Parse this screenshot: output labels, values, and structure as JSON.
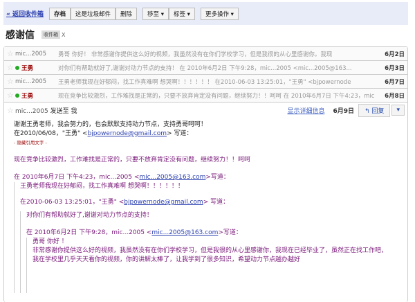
{
  "toolbar": {
    "back": "« 返回收件箱",
    "archive": "存档",
    "spam": "这是垃圾邮件",
    "delete": "删除",
    "move": "移至 ▾",
    "label": "标签 ▾",
    "more": "更多操作 ▾"
  },
  "subject": "感谢信",
  "tag": "收件箱",
  "tag_close": "X",
  "rows": [
    {
      "from": "mic...2005",
      "snippet": "勇哥 你好！ 非常感谢你提供这么好的视频，我虽然没有在你们学校学习，但是我很的从心里感谢你。我现",
      "date": "6月2日"
    },
    {
      "from": "王勇",
      "snippet": "对你们有帮助就好了,谢谢对动力节点的支持！ 在 2010年6月2日 下午9:28，mic...2005 <mic...2005@163...",
      "date": "6月3日"
    },
    {
      "from": "mic...2005",
      "snippet": "王勇老师我现在好郁闷，找工作真难啊 想哭啊！！！！！！ 在2010-06-03 13:25:01，\"王勇\" <bjpowernode",
      "date": "6月7日"
    },
    {
      "from": "王勇",
      "snippet": "现在竞争比较激烈，工作难找是正常的，只要不放弃肯定没有问题，继续努力！！呵呵 在 2010年6月7日 下午4:23，mic",
      "date": "6月8日"
    }
  ],
  "open": {
    "from": "mic...2005",
    "to": "发送至 我",
    "details": "显示详细信息",
    "date": "6月9日",
    "reply": "回复",
    "more": "▾",
    "l1": "谢谢王勇老师，我会努力的，也会默默支持动力节点，支持勇哥呵呵！",
    "l2a": "在2010/06/08，\"王勇\" <",
    "email1": "bjpowernode@gmail.com",
    "l2b": "> 写道：",
    "hidden": "- 隐藏引用文字 -",
    "l3": "现在竞争比较激烈，工作难找是正常的，只要不放弃肯定没有问题，继续努力！！呵呵",
    "l4a": "在 2010年6月7日 下午4:23，mic...2005 <",
    "email2": "mic...2005@163.com",
    "l4b": ">写道：",
    "l5": "王勇老师我现在好郁闷，找工作真难啊 想哭啊！！！！！！",
    "l6a": "在2010-06-03 13:25:01，\"王勇\" <",
    "email3": "bjpowernode@gmail.com",
    "l6b": "> 写道：",
    "l7": "对你们有帮助就好了,谢谢对动力节点的支持！",
    "l8a": "在 2010年6月2日 下午9:28，mic...2005 <",
    "email4": "mic...2005@163.com",
    "l8b": ">写道：",
    "l9": "勇哥 你好 ！",
    "l10": "非常感谢你提供这么好的视频，我虽然没有在你们学校学习，但是我很的从心里感谢你，我现在已经毕业了，虽然正在找工作吧，",
    "l11": "我在学校里几乎天天看你的视频，你的讲解太棒了，让我学到了很多知识，希望动力节点越办越好"
  }
}
